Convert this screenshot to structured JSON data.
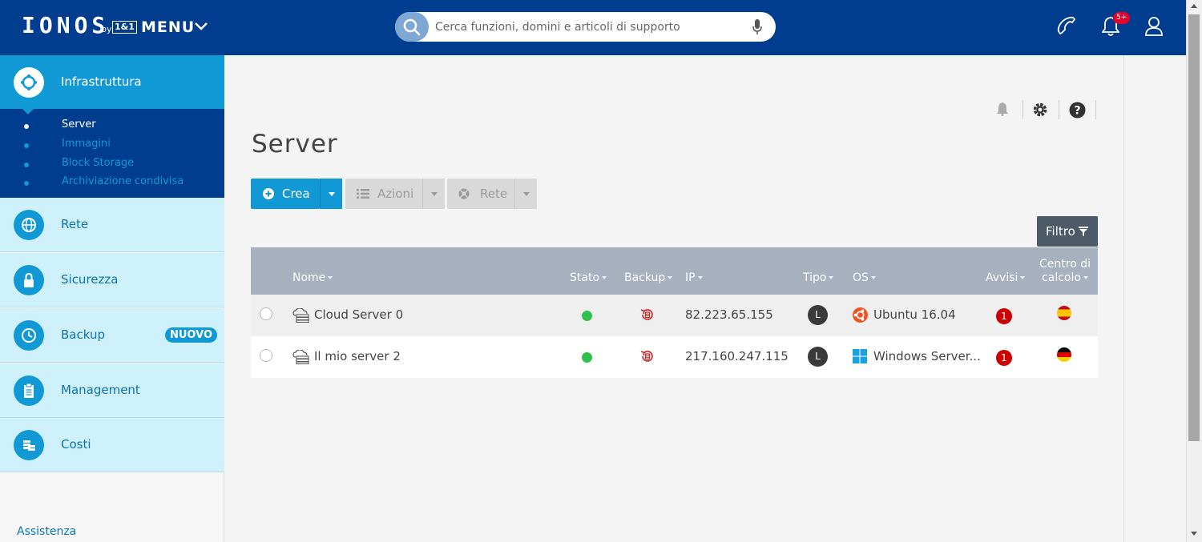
{
  "header": {
    "logo": "IONOS",
    "logo_by": "by",
    "logo_brand": "1&1",
    "menu_label": "MENU",
    "search_placeholder": "Cerca funzioni, domini e articoli di supporto",
    "notification_count": "5+",
    "icons": [
      "search-icon",
      "microphone-icon",
      "phone-icon",
      "bell-icon",
      "user-icon"
    ]
  },
  "sidebar": {
    "active": {
      "label": "Infrastruttura",
      "icon": "infrastructure-icon"
    },
    "subitems": [
      {
        "label": "Server",
        "active": true
      },
      {
        "label": "Immagini",
        "active": false
      },
      {
        "label": "Block Storage",
        "active": false
      },
      {
        "label": "Archiviazione condivisa",
        "active": false
      }
    ],
    "items": [
      {
        "label": "Rete",
        "icon": "globe-icon"
      },
      {
        "label": "Sicurezza",
        "icon": "lock-icon"
      },
      {
        "label": "Backup",
        "icon": "clock-icon",
        "badge": "NUOVO"
      },
      {
        "label": "Management",
        "icon": "clipboard-icon"
      },
      {
        "label": "Costi",
        "icon": "coins-icon"
      }
    ],
    "footer_link": "Assistenza"
  },
  "main": {
    "title": "Server",
    "toolbar": {
      "create": "Crea",
      "actions": "Azioni",
      "network": "Rete",
      "filter": "Filtro"
    },
    "table": {
      "headers": {
        "name": "Nome",
        "status": "Stato",
        "backup": "Backup",
        "ip": "IP",
        "type": "Tipo",
        "os": "OS",
        "alerts": "Avvisi",
        "datacenter_line1": "Centro di",
        "datacenter_line2": "calcolo"
      },
      "rows": [
        {
          "name": "Cloud Server 0",
          "ip": "82.223.65.155",
          "type": "L",
          "os": "Ubuntu 16.04",
          "alerts": "1",
          "datacenter_flag": "spain-flag",
          "status_color": "#2fc24a"
        },
        {
          "name": "Il mio server 2",
          "ip": "217.160.247.115",
          "type": "L",
          "os": "Windows Server...",
          "alerts": "1",
          "datacenter_flag": "germany-flag",
          "status_color": "#2fc24a"
        }
      ]
    }
  },
  "colors": {
    "header_bg": "#003d8f",
    "accent": "#1199d6",
    "sidebar_item_bg": "#cff1fb",
    "table_header_bg": "#a6b0be",
    "alert": "#cc0000",
    "ubuntu": "#e95420",
    "windows": "#1ba1e2"
  }
}
